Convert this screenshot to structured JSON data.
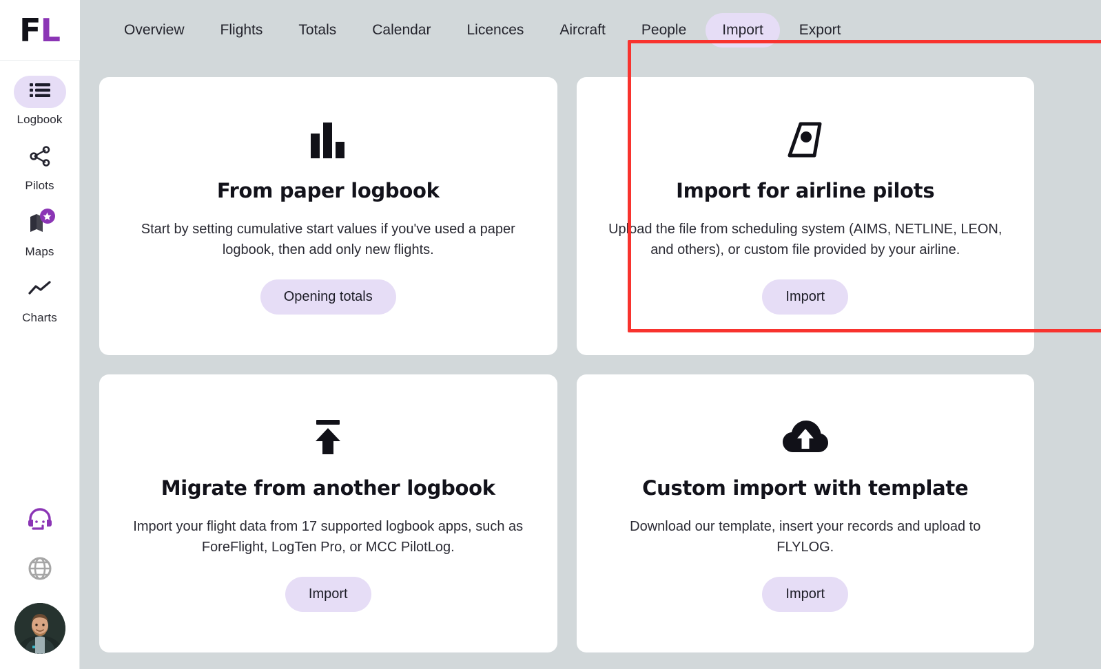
{
  "brand": {
    "logo_first": "F",
    "logo_second": "L",
    "logo_color_first": "#111118",
    "logo_color_second": "#8B35B5"
  },
  "theme": {
    "background": "#d2d8da",
    "card_background": "#ffffff",
    "accent_pill": "#e6ddf6",
    "accent_purple": "#8B35B5",
    "highlight_red": "#f8332e",
    "text_primary": "#12121a"
  },
  "sidebar": {
    "items": [
      {
        "label": "Logbook",
        "icon": "list-icon",
        "active": true
      },
      {
        "label": "Pilots",
        "icon": "share-nodes-icon",
        "active": false
      },
      {
        "label": "Maps",
        "icon": "map-icon",
        "active": false,
        "badge": "star"
      },
      {
        "label": "Charts",
        "icon": "line-chart-icon",
        "active": false
      }
    ],
    "bottom": [
      {
        "icon": "headset-support-icon",
        "color": "#8B35B5"
      },
      {
        "icon": "globe-icon",
        "color": "#a6a6a6"
      }
    ],
    "avatar": {
      "icon": "user-avatar",
      "alt": "User profile photo"
    }
  },
  "topnav": {
    "tabs": [
      {
        "label": "Overview",
        "active": false
      },
      {
        "label": "Flights",
        "active": false
      },
      {
        "label": "Totals",
        "active": false
      },
      {
        "label": "Calendar",
        "active": false
      },
      {
        "label": "Licences",
        "active": false
      },
      {
        "label": "Aircraft",
        "active": false
      },
      {
        "label": "People",
        "active": false
      },
      {
        "label": "Import",
        "active": true
      },
      {
        "label": "Export",
        "active": false
      }
    ]
  },
  "cards": [
    {
      "icon": "bar-chart-icon",
      "title": "From paper logbook",
      "description": "Start by setting cumulative start values if you've used a paper logbook, then add only new flights.",
      "button": "Opening totals",
      "highlighted": false
    },
    {
      "icon": "airplane-tail-icon",
      "title": "Import for airline pilots",
      "description": "Upload the file from scheduling system (AIMS, NETLINE, LEON, and others), or custom file provided by your airline.",
      "button": "Import",
      "highlighted": false
    },
    {
      "icon": "upload-to-line-icon",
      "title": "Migrate from another logbook",
      "description": "Import your flight data from 17 supported logbook apps, such as ForeFlight, LogTen Pro, or MCC PilotLog.",
      "button": "Import",
      "highlighted": false
    },
    {
      "icon": "cloud-upload-icon",
      "title": "Custom import with template",
      "description": "Download our template, insert your records and upload to FLYLOG.",
      "button": "Import",
      "highlighted": true
    }
  ]
}
